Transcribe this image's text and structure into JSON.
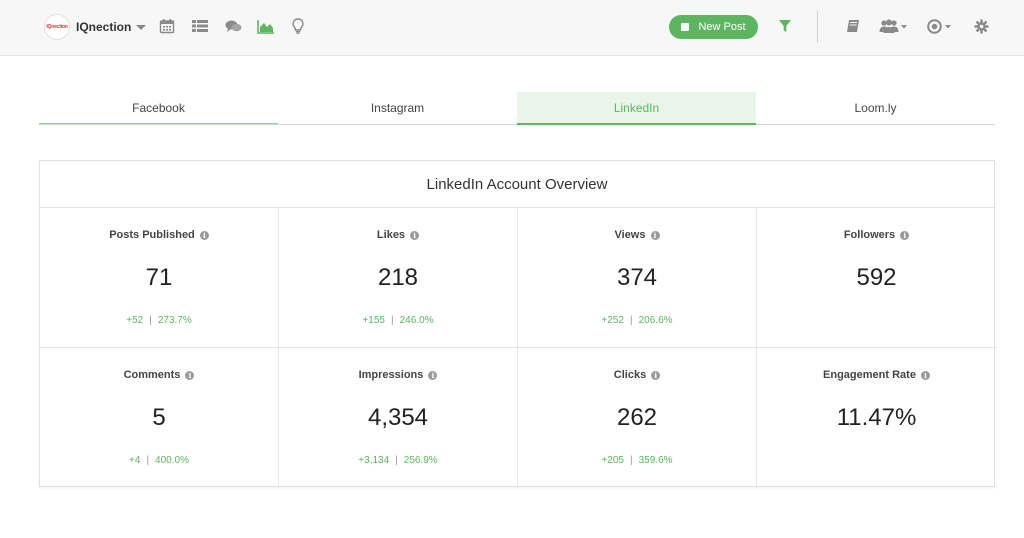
{
  "header": {
    "brand_name": "IQnection",
    "logo_text": "IQnection",
    "new_post_label": "New Post",
    "nav_icons": [
      "calendar-icon",
      "list-icon",
      "chat-icon",
      "analytics-icon",
      "lightbulb-icon"
    ],
    "right_icons": [
      "filter-icon",
      "book-icon",
      "users-icon",
      "account-icon",
      "settings-icon"
    ],
    "accent_color": "#5cb660"
  },
  "tabs": [
    {
      "label": "Facebook",
      "active": false
    },
    {
      "label": "Instagram",
      "active": false
    },
    {
      "label": "LinkedIn",
      "active": true
    },
    {
      "label": "Loom.ly",
      "active": false
    }
  ],
  "overview": {
    "title": "LinkedIn Account Overview",
    "metrics": [
      {
        "label": "Posts Published",
        "value": "71",
        "delta": "+52",
        "percent": "273.7%"
      },
      {
        "label": "Likes",
        "value": "218",
        "delta": "+155",
        "percent": "246.0%"
      },
      {
        "label": "Views",
        "value": "374",
        "delta": "+252",
        "percent": "206.6%"
      },
      {
        "label": "Followers",
        "value": "592",
        "delta": "",
        "percent": ""
      },
      {
        "label": "Comments",
        "value": "5",
        "delta": "+4",
        "percent": "400.0%"
      },
      {
        "label": "Impressions",
        "value": "4,354",
        "delta": "+3,134",
        "percent": "256.9%"
      },
      {
        "label": "Clicks",
        "value": "262",
        "delta": "+205",
        "percent": "359.6%"
      },
      {
        "label": "Engagement Rate",
        "value": "11.47%",
        "delta": "",
        "percent": ""
      }
    ]
  }
}
